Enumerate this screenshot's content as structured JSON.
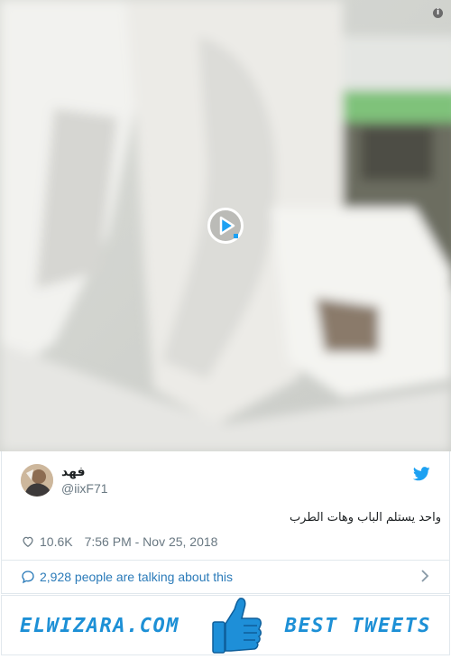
{
  "video": {
    "info_icon": "info-icon",
    "play_icon": "play-icon"
  },
  "tweet": {
    "display_name": "فهد",
    "handle": "@iixF71",
    "text": "واحد يستلم الباب وهات الطرب",
    "likes": "10.6K",
    "timestamp": "7:56 PM - Nov 25, 2018",
    "talking": "2,928 people are talking about this",
    "accent_color": "#1da1f2",
    "link_color": "#2b7bb9"
  },
  "banner": {
    "left_text": "ELWIZARA.COM",
    "right_text": "BEST TWEETS",
    "color": "#1d90d6"
  }
}
